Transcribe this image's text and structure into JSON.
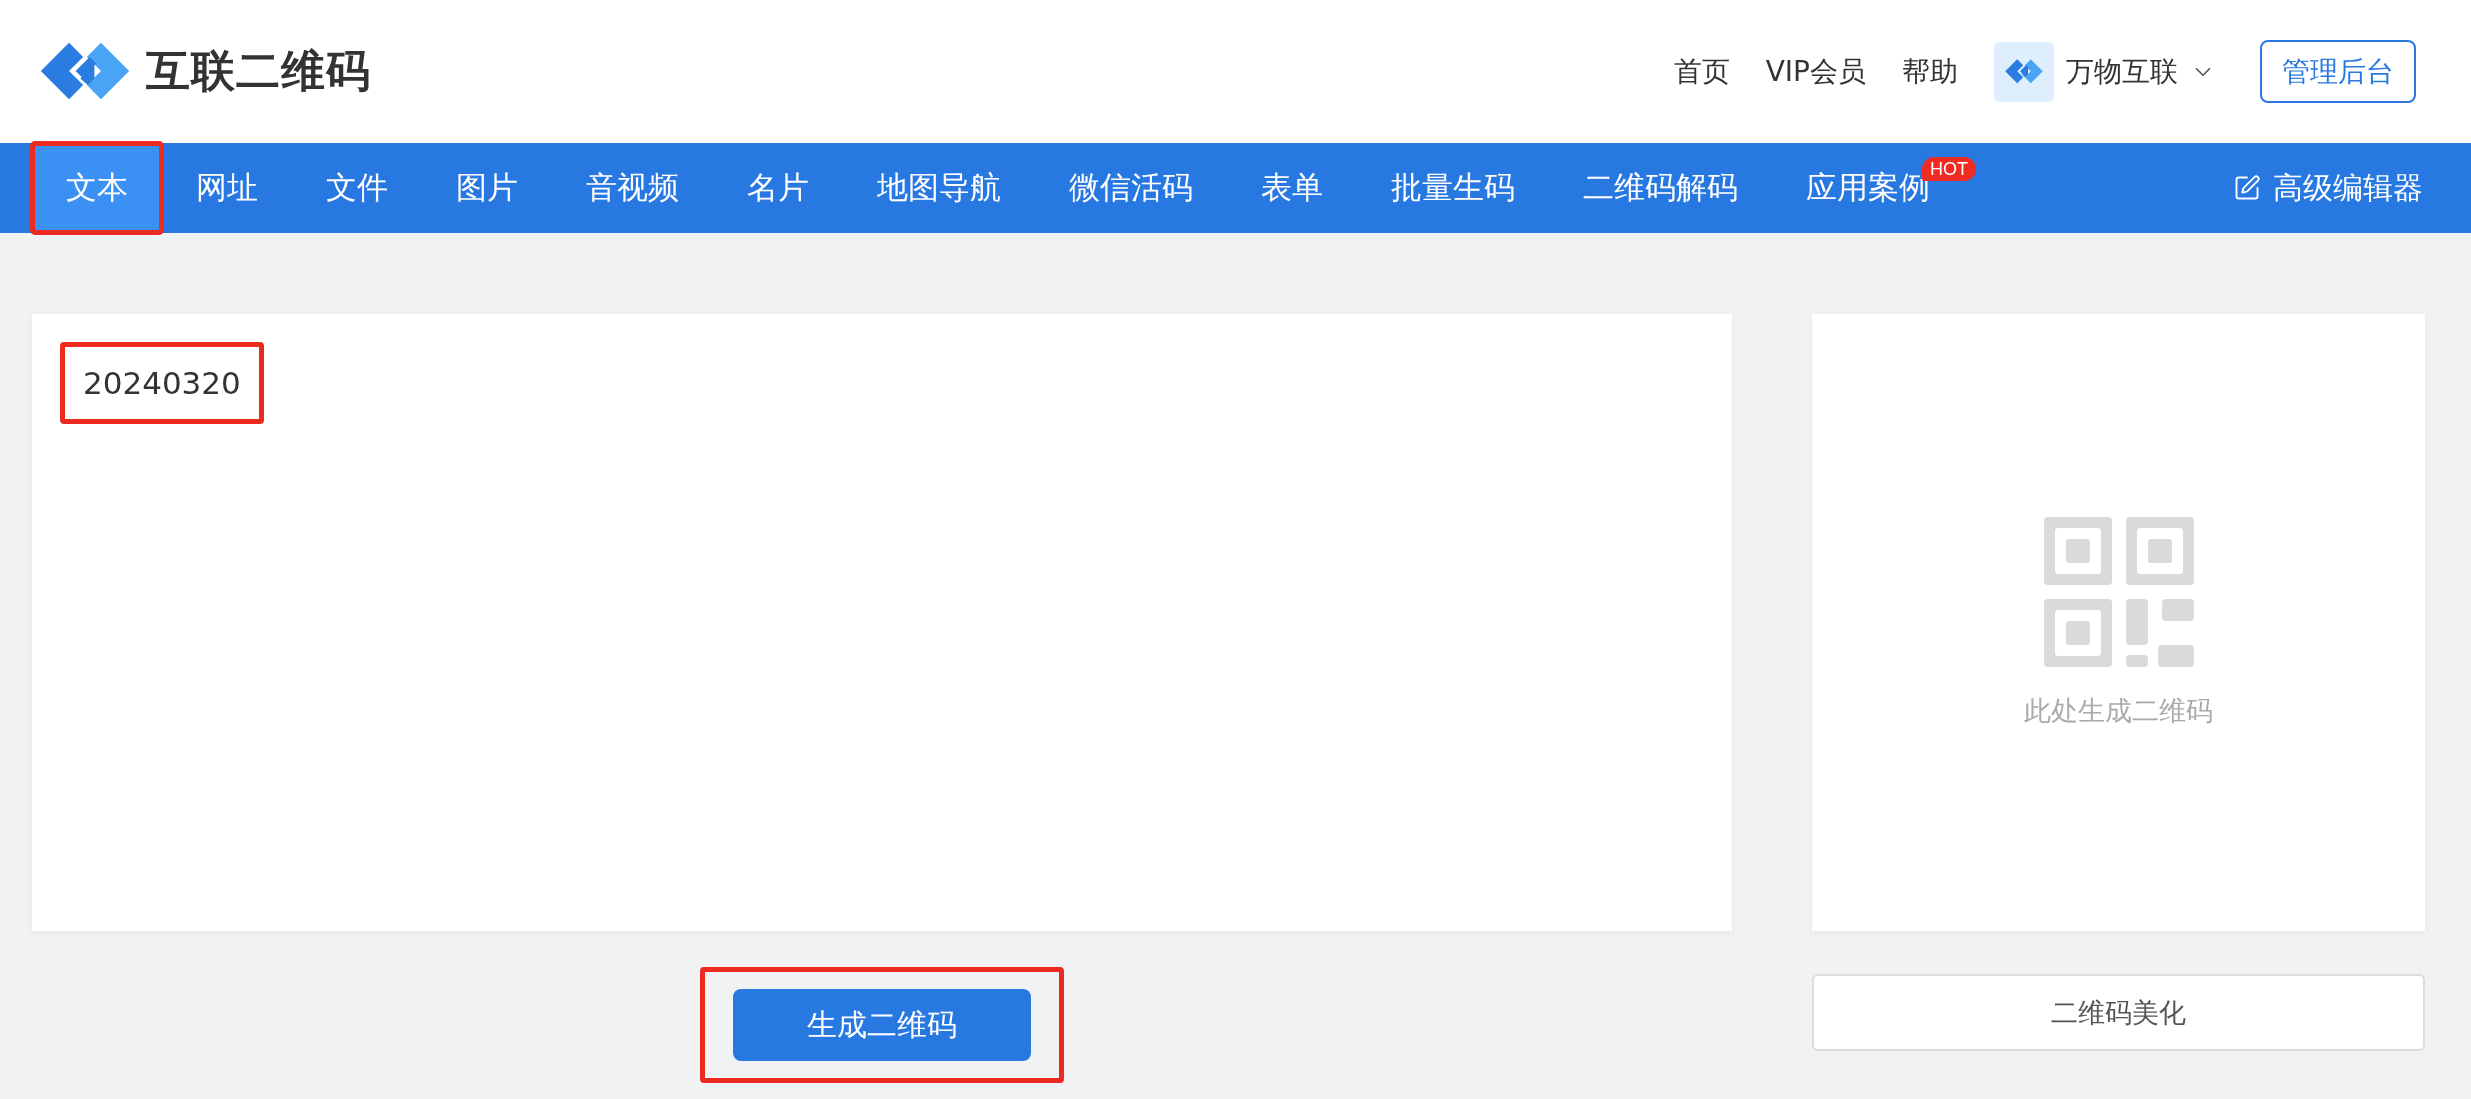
{
  "header": {
    "logo_text": "互联二维码",
    "links": [
      "首页",
      "VIP会员",
      "帮助"
    ],
    "account_name": "万物互联",
    "admin_button": "管理后台"
  },
  "nav": {
    "tabs": [
      {
        "label": "文本",
        "selected": true,
        "highlighted": true
      },
      {
        "label": "网址",
        "selected": false,
        "highlighted": false
      },
      {
        "label": "文件",
        "selected": false,
        "highlighted": false
      },
      {
        "label": "图片",
        "selected": false,
        "highlighted": false
      },
      {
        "label": "音视频",
        "selected": false,
        "highlighted": false
      },
      {
        "label": "名片",
        "selected": false,
        "highlighted": false
      },
      {
        "label": "地图导航",
        "selected": false,
        "highlighted": false
      },
      {
        "label": "微信活码",
        "selected": false,
        "highlighted": false
      },
      {
        "label": "表单",
        "selected": false,
        "highlighted": false
      },
      {
        "label": "批量生码",
        "selected": false,
        "highlighted": false
      },
      {
        "label": "二维码解码",
        "selected": false,
        "highlighted": false
      },
      {
        "label": "应用案例",
        "selected": false,
        "highlighted": false,
        "badge": "HOT"
      }
    ],
    "editor_link": "高级编辑器"
  },
  "editor": {
    "value": "20240320",
    "highlighted": true
  },
  "generate_button": {
    "label": "生成二维码",
    "highlighted": true
  },
  "preview": {
    "caption": "此处生成二维码"
  },
  "beautify_button": "二维码美化"
}
